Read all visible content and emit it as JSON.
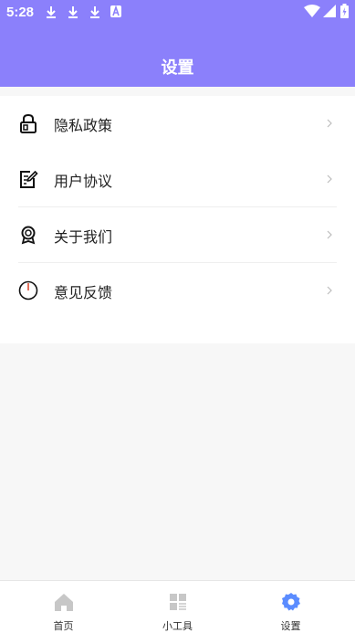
{
  "status_bar": {
    "time": "5:28"
  },
  "header": {
    "title": "设置"
  },
  "menu": {
    "items": [
      {
        "label": "隐私政策",
        "icon": "lock-icon"
      },
      {
        "label": "用户协议",
        "icon": "document-edit-icon"
      },
      {
        "label": "关于我们",
        "icon": "award-icon"
      },
      {
        "label": "意见反馈",
        "icon": "power-icon"
      }
    ]
  },
  "tabs": [
    {
      "label": "首页",
      "icon": "home-icon"
    },
    {
      "label": "小工具",
      "icon": "grid-icon"
    },
    {
      "label": "设置",
      "icon": "gear-icon",
      "active": true
    }
  ],
  "colors": {
    "accent": "#8b80fb",
    "active_tab": "#5b8cff",
    "inactive_tab": "#c7c7c7"
  }
}
